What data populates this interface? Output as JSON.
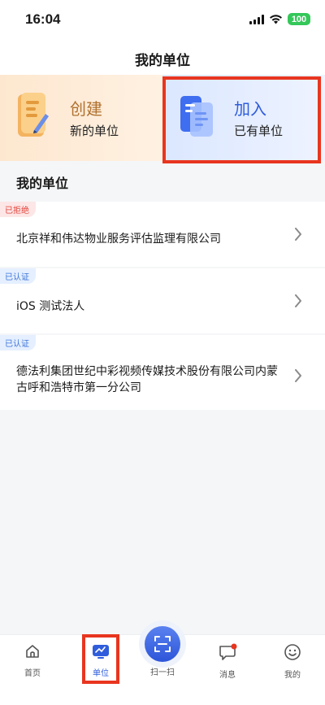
{
  "status": {
    "time": "16:04",
    "battery": "100"
  },
  "nav": {
    "title": "我的单位"
  },
  "banner": {
    "create": {
      "title": "创建",
      "subtitle": "新的单位"
    },
    "join": {
      "title": "加入",
      "subtitle": "已有单位"
    }
  },
  "section": {
    "title": "我的单位"
  },
  "units": [
    {
      "status": "已拒绝",
      "name": "北京祥和伟达物业服务评估监理有限公司"
    },
    {
      "status": "已认证",
      "name": "iOS 测试法人"
    },
    {
      "status": "已认证",
      "name": "德法利集团世纪中彩视频传媒技术股份有限公司内蒙古呼和浩特市第一分公司"
    }
  ],
  "tabs": {
    "home": "首页",
    "unit": "单位",
    "scan": "扫一扫",
    "messages": "消息",
    "mine": "我的"
  },
  "colors": {
    "accent": "#2f5ddb",
    "highlight_border": "#e8351f",
    "rejected": "#e0453c",
    "verified": "#3d75d8"
  }
}
